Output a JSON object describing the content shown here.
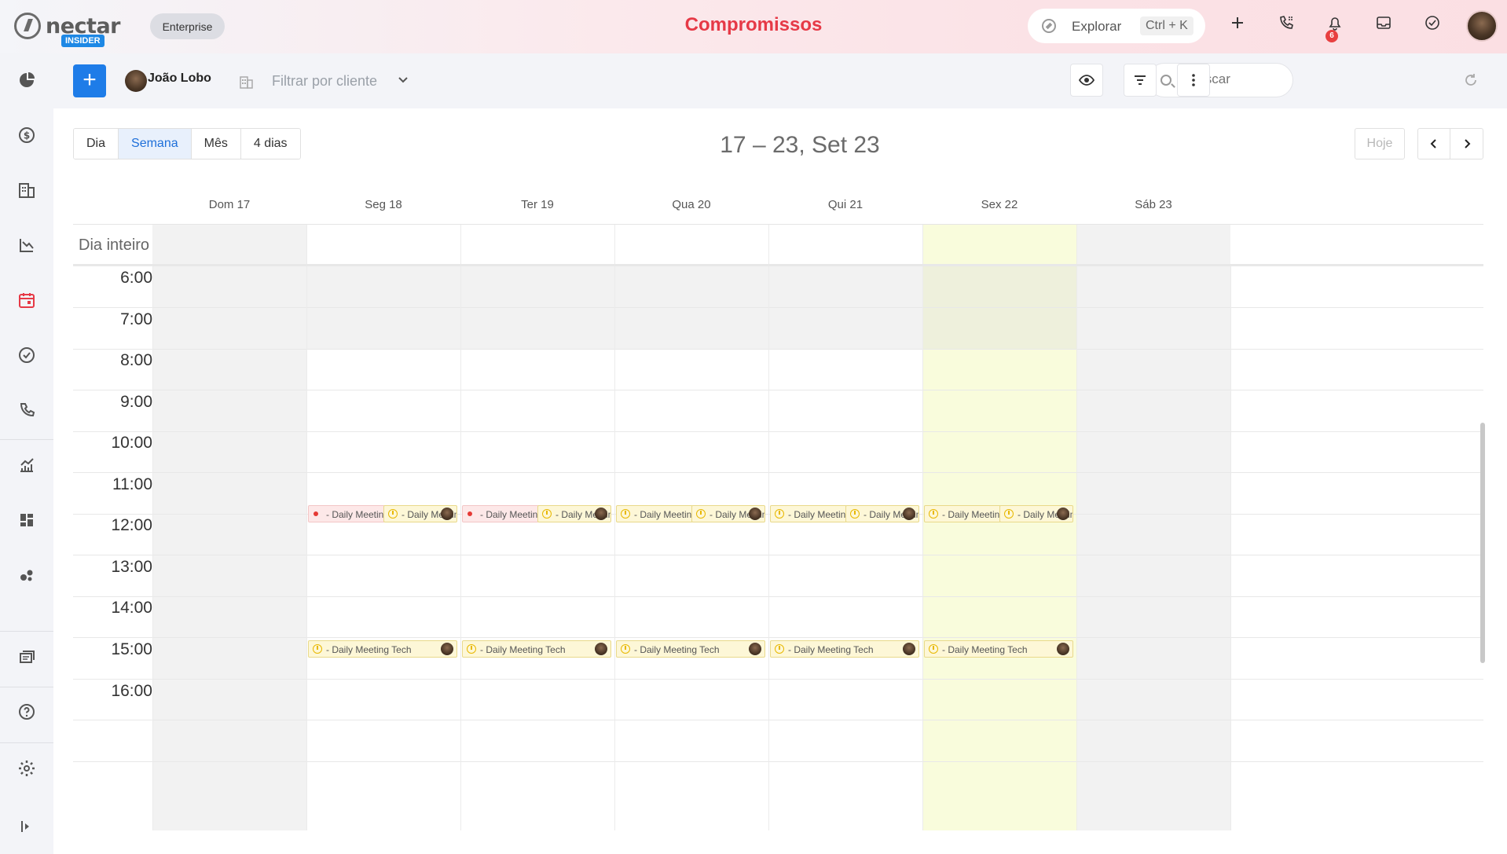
{
  "app": {
    "logo_text": "nectar",
    "logo_badge": "INSIDER",
    "plan": "Enterprise",
    "page_title": "Compromissos",
    "explore_label": "Explorar",
    "explore_shortcut": "Ctrl + K",
    "notifications_count": "6",
    "accent_color": "#e63946",
    "primary_color": "#1e7ce8"
  },
  "toolbar": {
    "add_label": "+",
    "user_name": "João Lobo",
    "filter_placeholder": "Filtrar por cliente",
    "search_placeholder": "Buscar"
  },
  "calendar": {
    "views": [
      "Dia",
      "Semana",
      "Mês",
      "4 dias"
    ],
    "active_view": "Semana",
    "date_range": "17 – 23, Set 23",
    "today_label": "Hoje",
    "allday_label": "Dia inteiro",
    "days": [
      "Dom 17",
      "Seg 18",
      "Ter 19",
      "Qua 20",
      "Qui 21",
      "Sex 22",
      "Sáb 23"
    ],
    "hours": [
      "6:00",
      "7:00",
      "8:00",
      "9:00",
      "10:00",
      "11:00",
      "12:00",
      "13:00",
      "14:00",
      "15:00",
      "16:00"
    ],
    "events": [
      {
        "title": "- Daily Meeting",
        "icon": "red-dot"
      },
      {
        "title": "- Daily Meeting",
        "icon": "clock"
      },
      {
        "title": "- Daily Meeting Tech",
        "icon": "clock"
      }
    ]
  }
}
